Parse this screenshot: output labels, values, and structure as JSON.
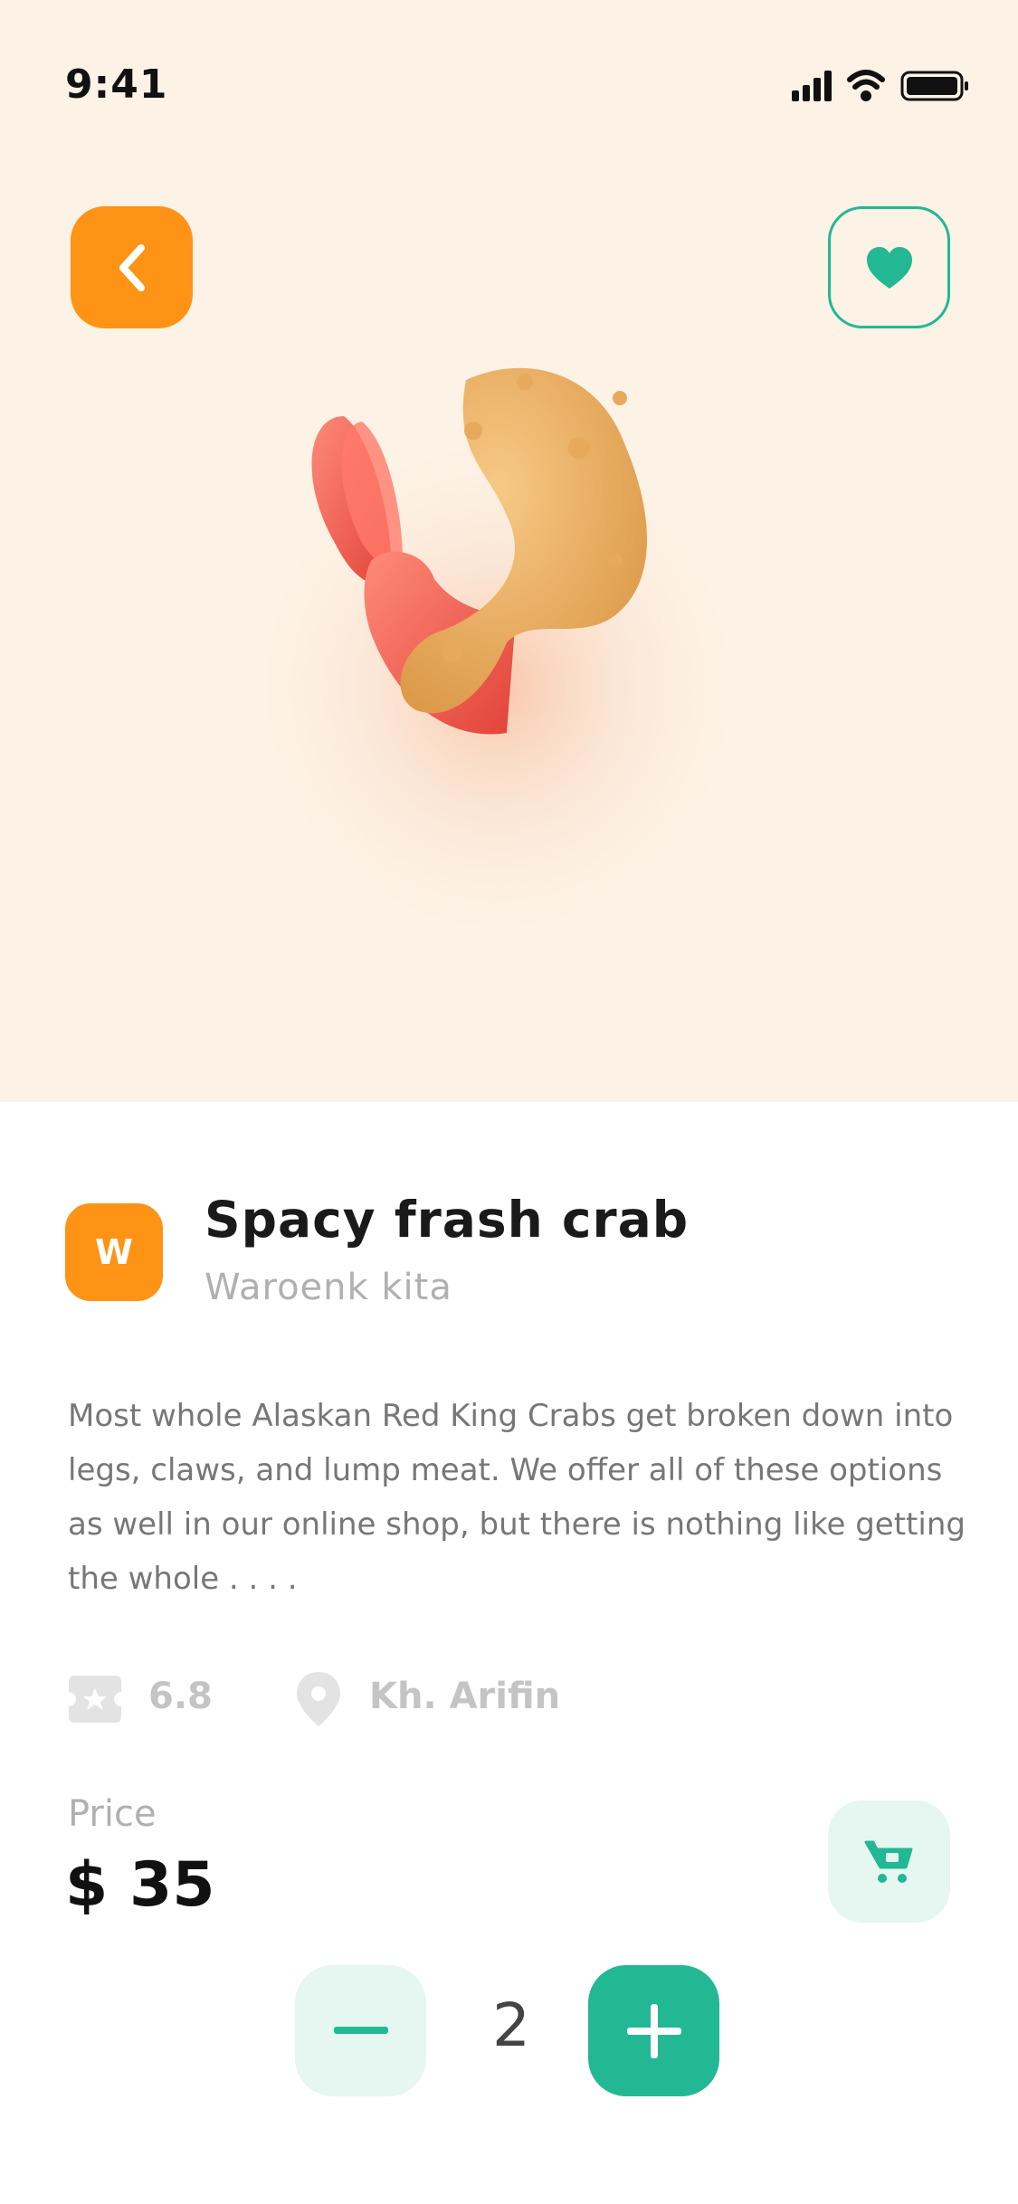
{
  "status_bar": {
    "time": "9:41"
  },
  "product": {
    "name": "Spacy frash crab",
    "vendor": "Waroenk kita",
    "vendor_initial": "W",
    "description": "Most whole Alaskan Red King Crabs get broken down into legs, claws, and lump meat. We offer all of these options as well in our online shop, but there is nothing like getting the whole . . . .",
    "rating": "6.8",
    "location": "Kh. Arifin",
    "price_label": "Price",
    "price": "$ 35",
    "quantity": "2"
  },
  "colors": {
    "accent_orange": "#ff9315",
    "accent_green": "#23b894",
    "hero_bg": "#fdf2e6"
  },
  "icons": [
    "back-chevron-icon",
    "heart-icon",
    "ticket-star-icon",
    "location-pin-icon",
    "cart-icon",
    "minus-icon",
    "plus-icon"
  ]
}
